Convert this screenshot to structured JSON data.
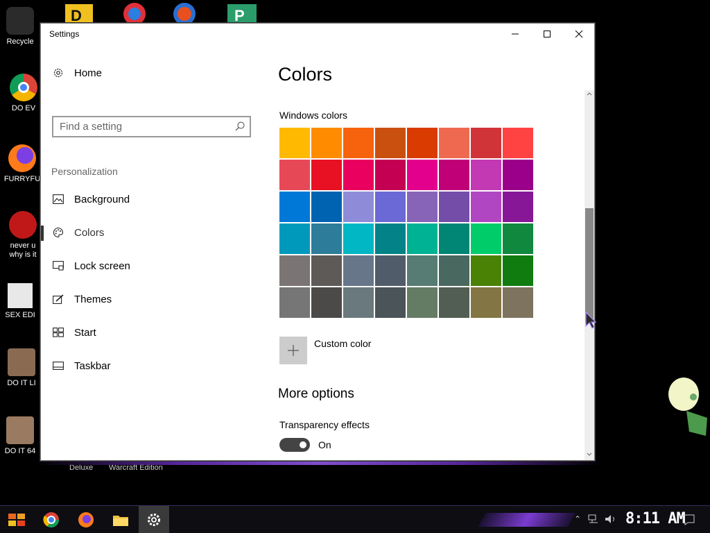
{
  "desktop": {
    "icons": [
      {
        "label": "Recycle",
        "color": "#2b2b2b"
      },
      {
        "label": "DO EV",
        "color": "#dd3322"
      },
      {
        "label": "FURRYFU",
        "color": "#e86a1a"
      },
      {
        "label": "never u",
        "label2": "why is it",
        "color": "#c01818"
      },
      {
        "label": "SEX EDI",
        "color": "#e8e8e8"
      },
      {
        "label": "DO IT LI",
        "color": "#8a6a50"
      },
      {
        "label": "DO IT 64",
        "color": "#9a7a60"
      }
    ],
    "under_labels": [
      "Deluxe",
      "Warcraft Edition"
    ]
  },
  "window": {
    "title": "Settings",
    "minimize": "—",
    "maximize": "☐",
    "close": "✕"
  },
  "sidebar": {
    "home": "Home",
    "search_placeholder": "Find a setting",
    "section": "Personalization",
    "items": [
      {
        "label": "Background",
        "icon": "image-icon"
      },
      {
        "label": "Colors",
        "icon": "palette-icon"
      },
      {
        "label": "Lock screen",
        "icon": "lock-screen-icon"
      },
      {
        "label": "Themes",
        "icon": "themes-icon"
      },
      {
        "label": "Start",
        "icon": "start-icon"
      },
      {
        "label": "Taskbar",
        "icon": "taskbar-icon"
      }
    ]
  },
  "main": {
    "title": "Colors",
    "windows_colors_label": "Windows colors",
    "swatches": [
      "#FFB900",
      "#FF8C00",
      "#F7630C",
      "#CA5010",
      "#DA3B01",
      "#EF6950",
      "#D13438",
      "#FF4343",
      "#E74856",
      "#E81123",
      "#EA005E",
      "#C30052",
      "#E3008C",
      "#BF0077",
      "#C239B3",
      "#9A0089",
      "#0078D7",
      "#0063B1",
      "#8E8CD8",
      "#6B69D6",
      "#8764B8",
      "#744DA9",
      "#B146C2",
      "#881798",
      "#0099BC",
      "#2D7D9A",
      "#00B7C3",
      "#038387",
      "#00B294",
      "#018574",
      "#00CC6A",
      "#10893E",
      "#7A7574",
      "#5D5A58",
      "#68768A",
      "#515C6B",
      "#567C73",
      "#486860",
      "#498205",
      "#107C10",
      "#767676",
      "#4C4A48",
      "#69797E",
      "#4A5459",
      "#647C64",
      "#525E54",
      "#847545",
      "#7E735F"
    ],
    "custom_color": "Custom color",
    "more_options": "More options",
    "transparency_label": "Transparency effects",
    "transparency_state": "On"
  },
  "taskbar": {
    "clock": "8:11 AM"
  }
}
